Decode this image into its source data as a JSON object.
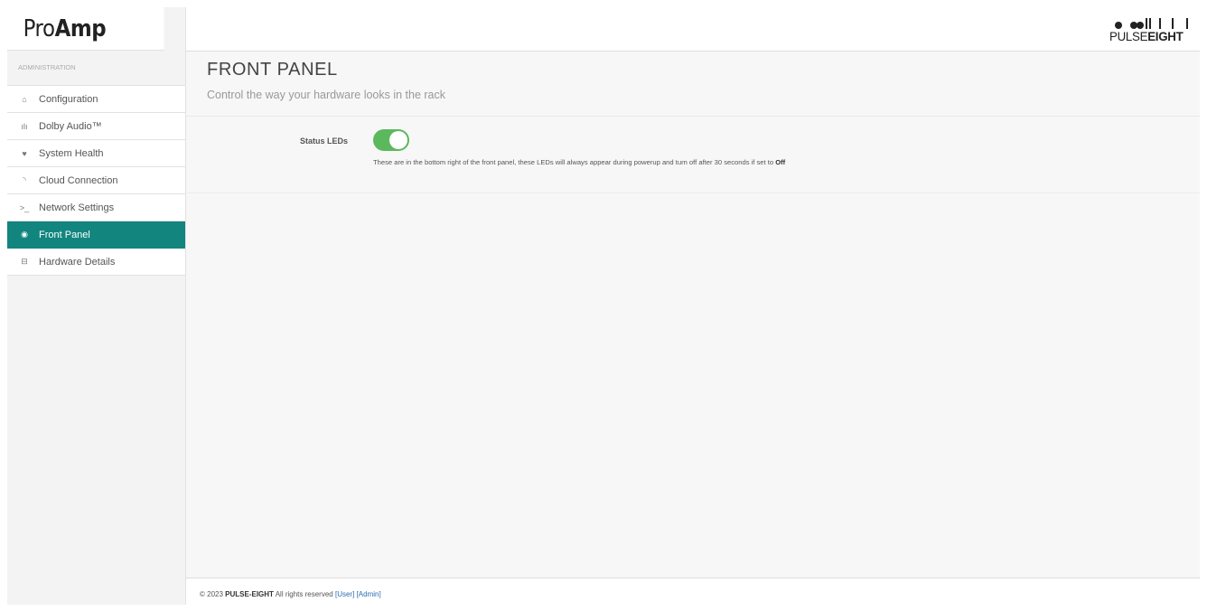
{
  "brand": {
    "pro": "Pro",
    "amp": "Amp"
  },
  "logo": {
    "pulse": "PULSE",
    "eight": "EIGHT"
  },
  "sidebar": {
    "section_label": "ADMINISTRATION",
    "items": [
      {
        "label": "Configuration",
        "icon": "home-icon",
        "glyph": "⌂"
      },
      {
        "label": "Dolby Audio™",
        "icon": "audio-wave-icon",
        "glyph": "ılı"
      },
      {
        "label": "System Health",
        "icon": "heart-icon",
        "glyph": "♥"
      },
      {
        "label": "Cloud Connection",
        "icon": "rss-icon",
        "glyph": "◝"
      },
      {
        "label": "Network Settings",
        "icon": "terminal-icon",
        "glyph": ">_"
      },
      {
        "label": "Front Panel",
        "icon": "circle-dot-icon",
        "glyph": "◉",
        "active": true
      },
      {
        "label": "Hardware Details",
        "icon": "hdd-icon",
        "glyph": "⊟"
      }
    ]
  },
  "main": {
    "title": "FRONT PANEL",
    "subtitle": "Control the way your hardware looks in the rack",
    "settings": {
      "status_leds": {
        "label": "Status LEDs",
        "enabled": true,
        "help_prefix": "These are in the bottom right of the front panel, these LEDs will always appear during powerup and turn off after 30 seconds if set to",
        "help_bold": "Off"
      }
    }
  },
  "footer": {
    "copyright": "© 2023",
    "company": "PULSE-EIGHT",
    "rights": "All rights reserved",
    "user_link": "[User]",
    "admin_link": "[Admin]"
  },
  "colors": {
    "accent": "#12857f",
    "toggle_on": "#5cb85c",
    "link": "#2a6db0"
  }
}
